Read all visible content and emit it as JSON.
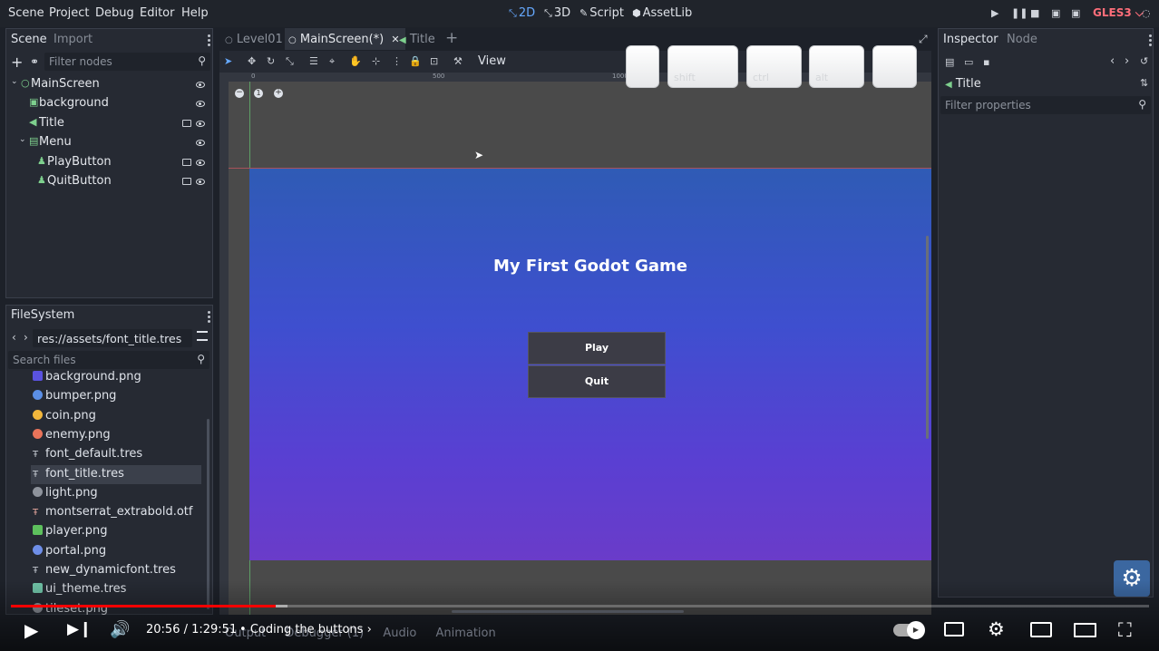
{
  "menu": {
    "items": [
      "Scene",
      "Project",
      "Debug",
      "Editor",
      "Help"
    ]
  },
  "workspaces": [
    {
      "label": "2D",
      "icon": "2d-icon",
      "active": true
    },
    {
      "label": "3D",
      "icon": "3d-icon",
      "active": false
    },
    {
      "label": "Script",
      "icon": "script-icon",
      "active": false
    },
    {
      "label": "AssetLib",
      "icon": "assetlib-icon",
      "active": false
    }
  ],
  "renderer": "GLES3",
  "scene_panel": {
    "tabs": [
      "Scene",
      "Import"
    ],
    "filter_placeholder": "Filter nodes",
    "nodes": [
      {
        "label": "MainScreen",
        "depth": 0,
        "type": "control",
        "signal": false
      },
      {
        "label": "background",
        "depth": 1,
        "type": "texture",
        "signal": false
      },
      {
        "label": "Title",
        "depth": 1,
        "type": "label",
        "signal": true
      },
      {
        "label": "Menu",
        "depth": 1,
        "type": "container",
        "signal": false
      },
      {
        "label": "PlayButton",
        "depth": 2,
        "type": "button",
        "signal": true
      },
      {
        "label": "QuitButton",
        "depth": 2,
        "type": "button",
        "signal": true
      }
    ]
  },
  "filesystem": {
    "title": "FileSystem",
    "path": "res://assets/font_title.tres",
    "search_placeholder": "Search files",
    "files": [
      {
        "name": "background.png",
        "color": "#5a52e0"
      },
      {
        "name": "bumper.png",
        "color": "#5b8fe6"
      },
      {
        "name": "coin.png",
        "color": "#f2b73c"
      },
      {
        "name": "enemy.png",
        "color": "#e8735a"
      },
      {
        "name": "font_default.tres",
        "color": "#bfc4cc"
      },
      {
        "name": "font_title.tres",
        "color": "#bfc4cc",
        "selected": true
      },
      {
        "name": "light.png",
        "color": "#8e939c"
      },
      {
        "name": "montserrat_extrabold.otf",
        "color": "#e2a39b"
      },
      {
        "name": "player.png",
        "color": "#5dc05d"
      },
      {
        "name": "portal.png",
        "color": "#6e8ee8"
      },
      {
        "name": "new_dynamicfont.tres",
        "color": "#bfc4cc"
      },
      {
        "name": "ui_theme.tres",
        "color": "#6fc2a6"
      },
      {
        "name": "tileset.png",
        "color": "#8e939c"
      }
    ]
  },
  "editor_tabs": [
    {
      "label": "Level01",
      "active": false
    },
    {
      "label": "MainScreen(*)",
      "active": true
    },
    {
      "label": "Title",
      "active": false
    }
  ],
  "viewport": {
    "view_menu": "View",
    "ruler_marks": [
      "0",
      "500",
      "1000"
    ],
    "game_title": "My First Godot Game",
    "buttons": [
      "Play",
      "Quit"
    ]
  },
  "keycaps": [
    "",
    "shift",
    "ctrl",
    "alt",
    ""
  ],
  "inspector": {
    "tabs": [
      "Inspector",
      "Node"
    ],
    "selected_node": "Title",
    "filter_placeholder": "Filter properties"
  },
  "bottom_dock": [
    "Output",
    "Debugger (1)",
    "Audio",
    "Animation"
  ],
  "player": {
    "time": "20:56 / 1:29:51",
    "chapter": "Coding the buttons",
    "progress": 0.233,
    "buffered": 0.243
  }
}
